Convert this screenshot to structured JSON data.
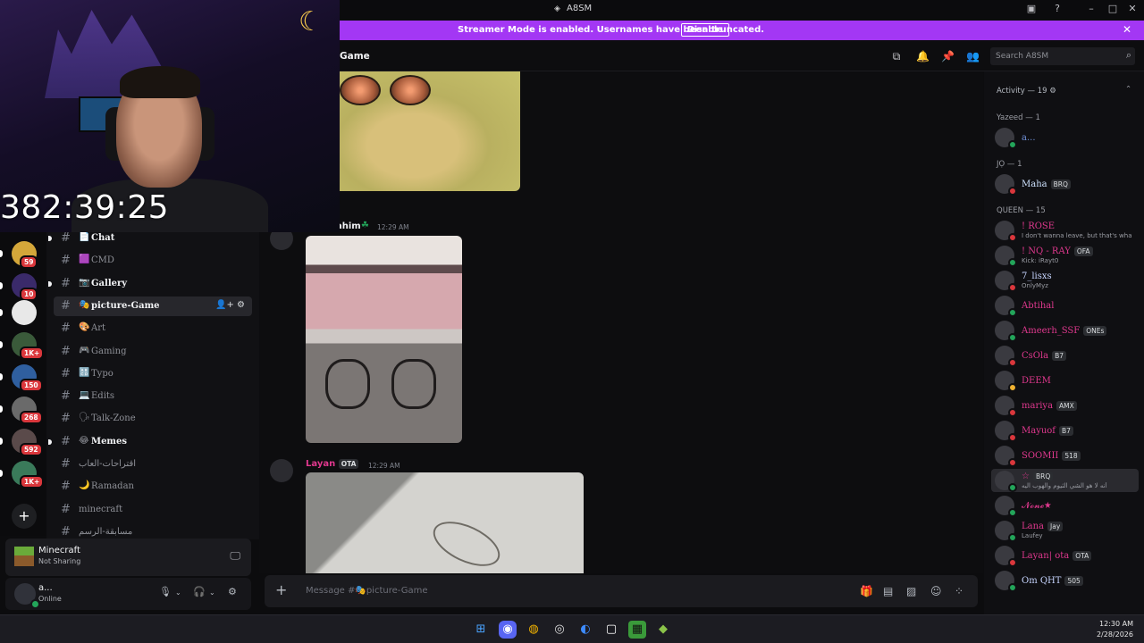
{
  "window": {
    "title": "A8SM"
  },
  "banner": {
    "message": "Streamer Mode is enabled. Usernames have been truncated.",
    "disable_label": "Disable"
  },
  "header": {
    "channel_name": "Game",
    "search_placeholder": "Search A8SM"
  },
  "webcam": {
    "timer": "382:39:25"
  },
  "servers": [
    {
      "badge": "59"
    },
    {
      "badge": "10"
    },
    {
      "badge": ""
    },
    {
      "badge": "1K+"
    },
    {
      "badge": "150"
    },
    {
      "badge": "268"
    },
    {
      "badge": "592"
    },
    {
      "badge": "1K+"
    }
  ],
  "channels": [
    {
      "emoji": "📄",
      "label": "Chat",
      "unread": true
    },
    {
      "emoji": "🟪",
      "label": "CMD",
      "unread": false
    },
    {
      "emoji": "📷",
      "label": "Gallery",
      "unread": true
    },
    {
      "emoji": "🎭",
      "label": "picture-Game",
      "active": true
    },
    {
      "emoji": "🎨",
      "label": "Art",
      "unread": false
    },
    {
      "emoji": "🎮",
      "label": "Gaming",
      "unread": false
    },
    {
      "emoji": "🔠",
      "label": "Typo",
      "unread": false
    },
    {
      "emoji": "💻",
      "label": "Edits",
      "unread": false
    },
    {
      "emoji": "🗣",
      "label": "Talk-Zone",
      "unread": false
    },
    {
      "emoji": "😂",
      "label": "Memes",
      "unread": true
    },
    {
      "emoji": "",
      "label": "اقتراحات-العاب",
      "unread": false
    },
    {
      "emoji": "🌙",
      "label": "Ramadan",
      "unread": false
    },
    {
      "emoji": "",
      "label": "minecraft",
      "unread": false
    },
    {
      "emoji": "",
      "label": "مسابقة-الرسم",
      "unread": false
    }
  ],
  "activity": {
    "game": "Minecraft",
    "status": "Not Sharing"
  },
  "user": {
    "name": "a...",
    "status": "Online"
  },
  "messages": [
    {
      "author": "ahim",
      "time": "12:29 AM"
    },
    {
      "author": "Layan",
      "tag": "OTA",
      "time": "12:29 AM"
    }
  ],
  "composer": {
    "placeholder": "Message #🎭picture-Game"
  },
  "members": {
    "activity_header": "Activity — 19",
    "sections": [
      {
        "title": "Yazeed — 1",
        "members": [
          {
            "name": "a...",
            "color": "#6f8fd6"
          }
        ]
      },
      {
        "title": "JỌ — 1",
        "members": [
          {
            "name": "Maha",
            "tag": "BRQ",
            "color": "#cfe3ff"
          }
        ]
      },
      {
        "title": "QUEEN — 15",
        "members": [
          {
            "name": "! ROSE",
            "sub": "I don't wanna leave, but that's wha",
            "color": "#e0388e"
          },
          {
            "name": "! NQ - RAY",
            "tag": "OFA",
            "sub": "Kick: iRayt0",
            "color": "#e0388e"
          },
          {
            "name": "7_lisxs",
            "sub": "OnlyMyz",
            "color": "#c7d5ff"
          },
          {
            "name": "Abtihal",
            "color": "#e0388e"
          },
          {
            "name": "Ameerh_SSF",
            "tag": "ONEs",
            "color": "#e0388e"
          },
          {
            "name": "CsOla",
            "tag": "B7",
            "color": "#e0388e"
          },
          {
            "name": "DEEM",
            "color": "#e0388e"
          },
          {
            "name": "mariya",
            "tag": "AMX",
            "color": "#e0388e"
          },
          {
            "name": "Mayuof",
            "tag": "B7",
            "color": "#e0388e"
          },
          {
            "name": "SOOMII",
            "tag": "518",
            "color": "#e0388e"
          },
          {
            "name": "☆",
            "tag": "BRQ",
            "sub": "أنه لا هو الشي الثيوم والهوب اليه",
            "color": "#e0388e"
          },
          {
            "name": "𝓝𝓸𝓷𝓮★",
            "color": "#e0388e"
          },
          {
            "name": "Lana",
            "tag": "Jay",
            "sub": "Laufey",
            "color": "#e0388e"
          },
          {
            "name": "Layan| ota",
            "tag": "OTA",
            "color": "#e0388e"
          },
          {
            "name": "Om QHT",
            "tag": "505",
            "color": "#c7d5ff"
          }
        ]
      }
    ]
  },
  "clock": {
    "time": "12:30 AM",
    "date": "2/28/2026"
  },
  "colors": {
    "banner": "#a337f4",
    "accent_pink": "#e0388e",
    "online": "#23a55a",
    "dnd": "#da373c"
  }
}
